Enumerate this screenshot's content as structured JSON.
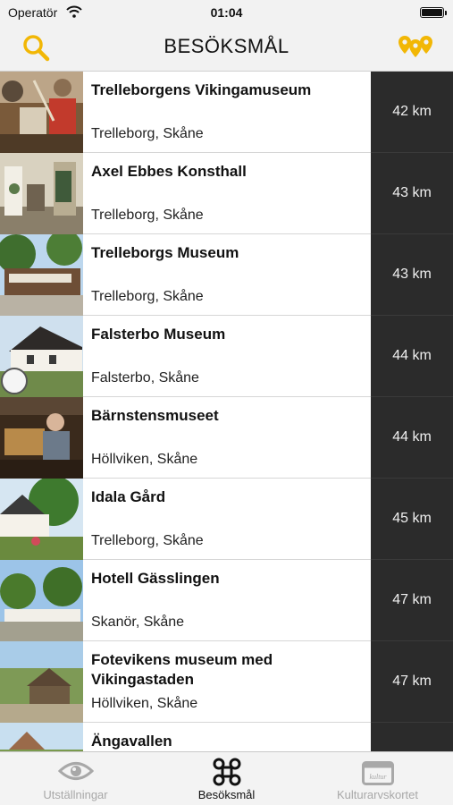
{
  "statusbar": {
    "carrier": "Operatör",
    "time": "01:04"
  },
  "navbar": {
    "title": "BESÖKSMÅL",
    "accent_color": "#f2b705"
  },
  "items": [
    {
      "name": "Trelleborgens Vikingamuseum",
      "place": "Trelleborg, Skåne",
      "distance": "42 km"
    },
    {
      "name": "Axel Ebbes Konsthall",
      "place": "Trelleborg, Skåne",
      "distance": "43 km"
    },
    {
      "name": "Trelleborgs Museum",
      "place": "Trelleborg, Skåne",
      "distance": "43 km"
    },
    {
      "name": "Falsterbo Museum",
      "place": "Falsterbo, Skåne",
      "distance": "44 km"
    },
    {
      "name": "Bärnstensmuseet",
      "place": "Höllviken, Skåne",
      "distance": "44 km"
    },
    {
      "name": "Idala Gård",
      "place": "Trelleborg, Skåne",
      "distance": "45 km"
    },
    {
      "name": "Hotell Gässlingen",
      "place": "Skanör, Skåne",
      "distance": "47 km"
    },
    {
      "name": "Fotevikens museum med Vikingastaden",
      "place": "Höllviken, Skåne",
      "distance": "47 km"
    },
    {
      "name": "Ängavallen",
      "place": "",
      "distance": ""
    }
  ],
  "tabs": [
    {
      "label": "Utställningar",
      "icon": "eye-icon",
      "active": false
    },
    {
      "label": "Besöksmål",
      "icon": "command-icon",
      "active": true
    },
    {
      "label": "Kulturarvskortet",
      "icon": "card-icon",
      "active": false
    }
  ],
  "card_logo_text": "kultur"
}
